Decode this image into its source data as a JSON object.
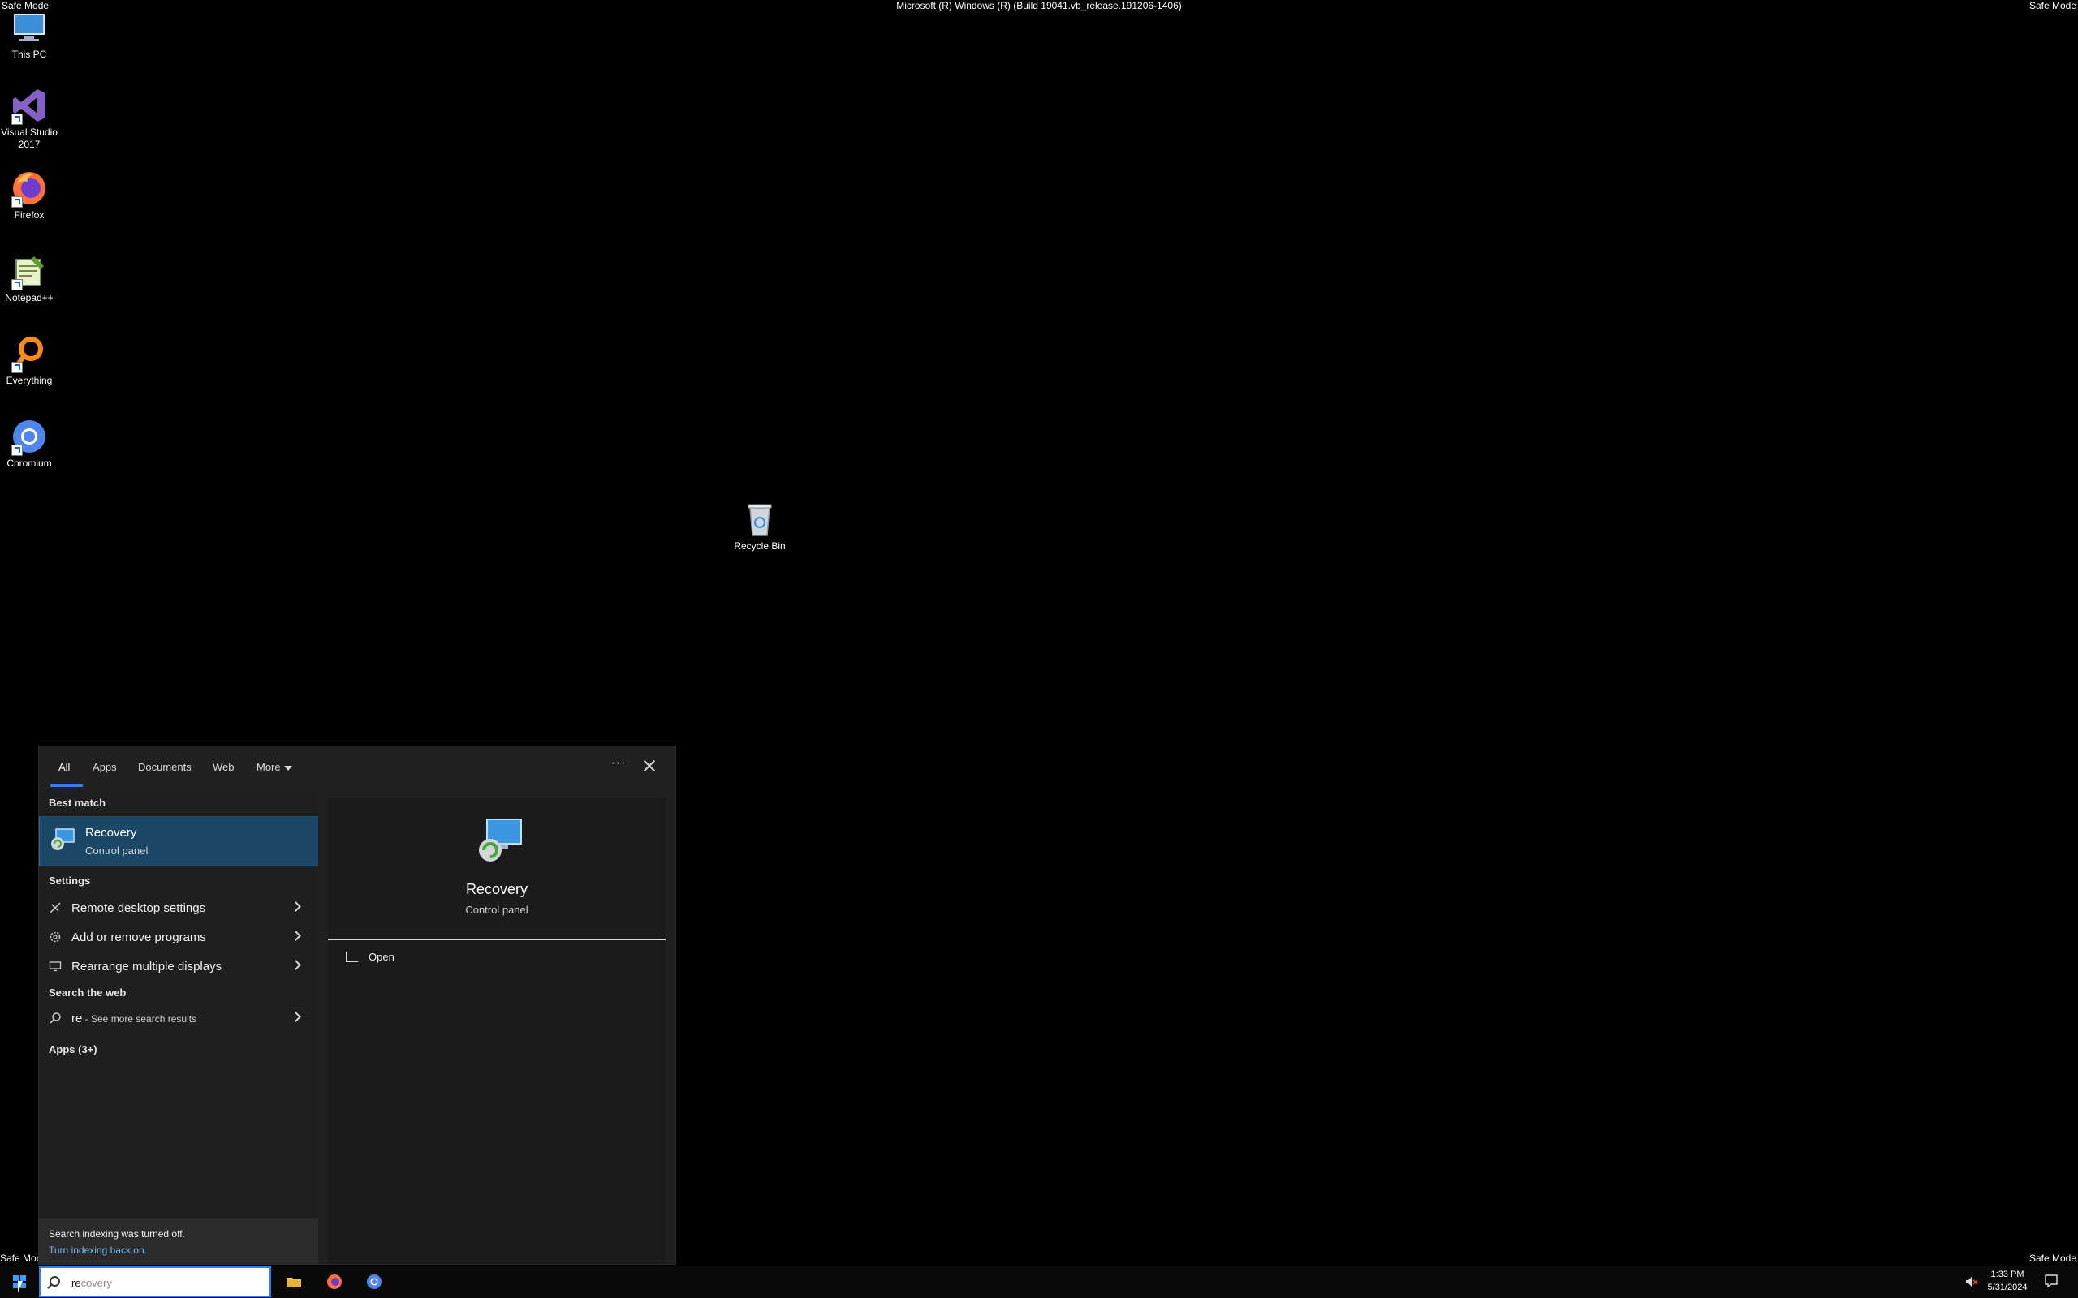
{
  "desktop": {
    "safe_mode_label": "Safe Mode",
    "safe_mode_label_truncated": "Safe Moc",
    "build_string": "Microsoft (R) Windows (R) (Build 19041.vb_release.191206-1406)",
    "icons": [
      {
        "label": "This PC",
        "icon": "computer-icon"
      },
      {
        "label": "Visual Studio 2017",
        "icon": "visual-studio-icon"
      },
      {
        "label": "Firefox",
        "icon": "firefox-icon"
      },
      {
        "label": "Notepad++",
        "icon": "notepadpp-icon"
      },
      {
        "label": "Everything",
        "icon": "everything-icon"
      },
      {
        "label": "Chromium",
        "icon": "chromium-icon"
      },
      {
        "label": "Recycle Bin",
        "icon": "recycle-bin-icon"
      }
    ]
  },
  "search_panel": {
    "tabs": [
      {
        "label": "All",
        "active": true
      },
      {
        "label": "Apps"
      },
      {
        "label": "Documents"
      },
      {
        "label": "Web"
      },
      {
        "label": "More"
      }
    ],
    "best_match_header": "Best match",
    "best_match": {
      "title": "Recovery",
      "subtitle": "Control panel",
      "icon": "recovery-icon"
    },
    "settings_header": "Settings",
    "settings_items": [
      {
        "label": "Remote desktop settings",
        "icon": "remote-desktop-icon"
      },
      {
        "label": "Add or remove programs",
        "icon": "gear-icon"
      },
      {
        "label": "Rearrange multiple displays",
        "icon": "display-icon"
      }
    ],
    "web_header": "Search the web",
    "web_item": {
      "query": "re",
      "suffix": " - See more search results",
      "icon": "search-icon"
    },
    "apps_header": "Apps (3+)",
    "indexing_notice": "Search indexing was turned off.",
    "indexing_link": "Turn indexing back on.",
    "detail": {
      "title": "Recovery",
      "subtitle": "Control panel",
      "open_label": "Open"
    }
  },
  "taskbar": {
    "search_typed": "re",
    "search_ghost": "covery",
    "pinned": [
      "file-explorer-icon",
      "firefox-icon",
      "chromium-icon"
    ],
    "time": "1:33 PM",
    "date": "5/31/2024"
  },
  "colors": {
    "accent": "#2f80ed",
    "selection": "#1a4766",
    "link": "#76b9ed"
  }
}
